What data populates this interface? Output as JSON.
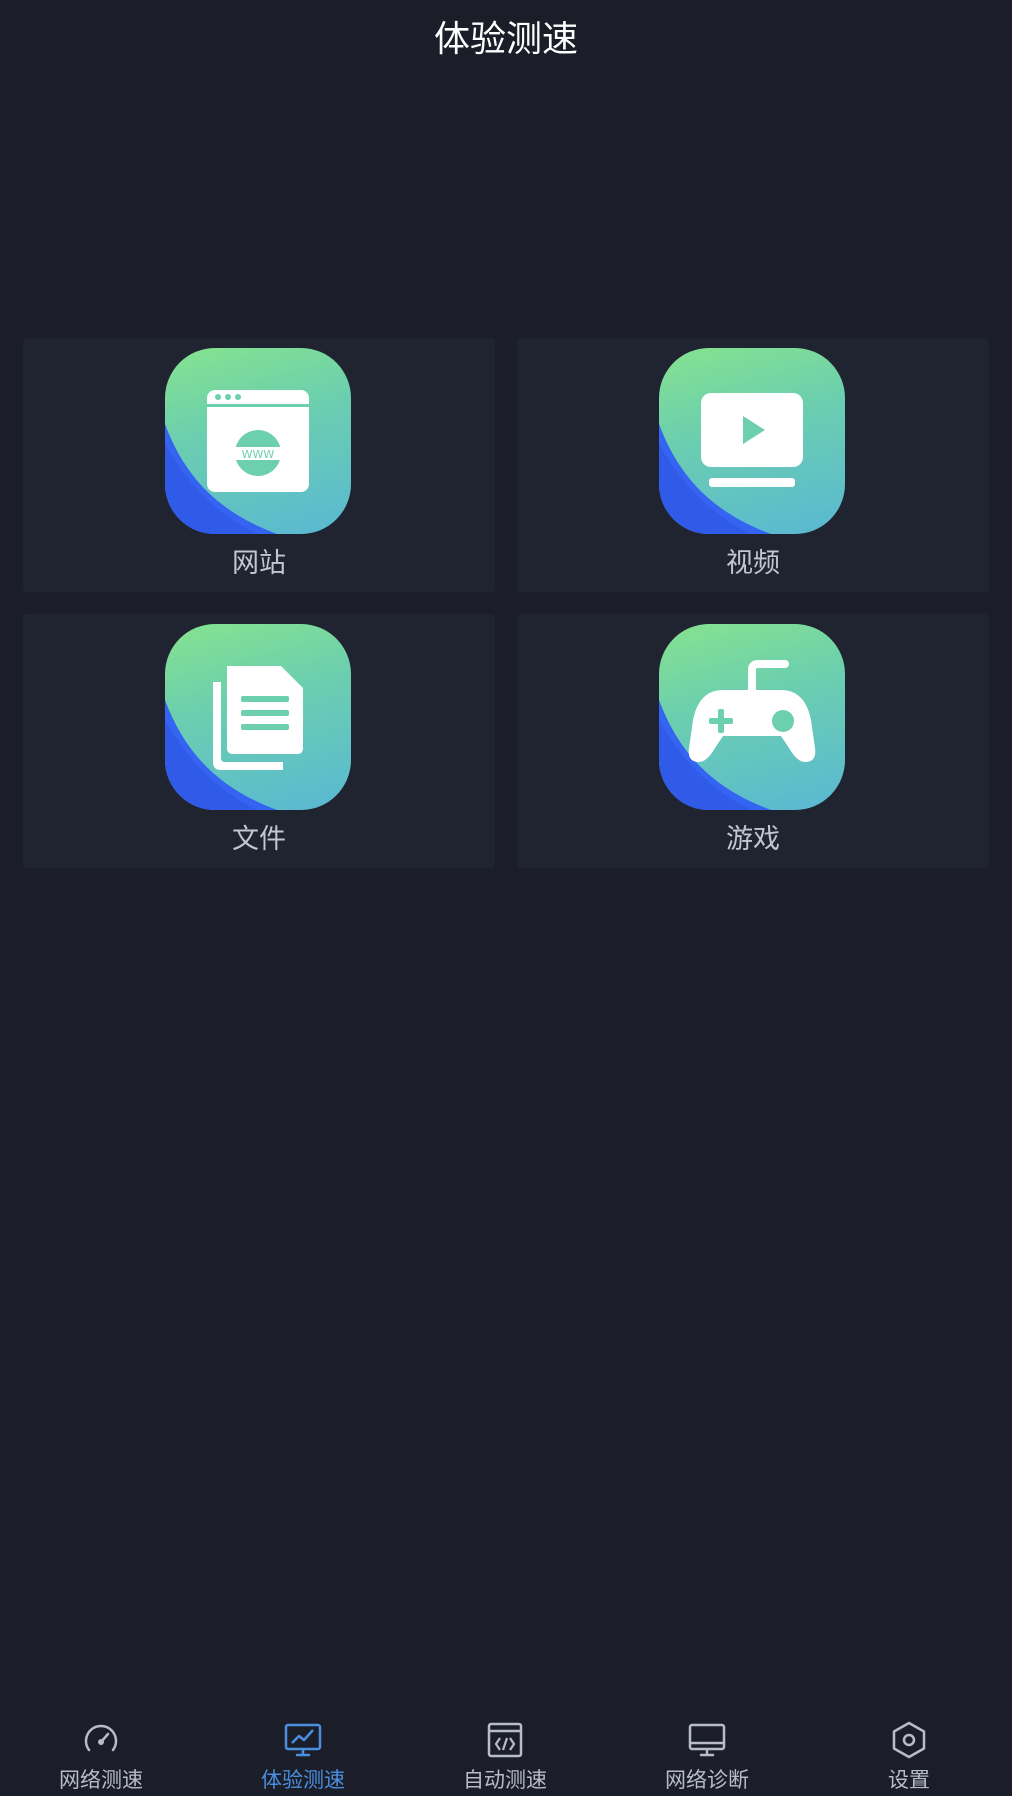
{
  "header": {
    "title": "体验测速"
  },
  "cards": [
    {
      "label": "网站",
      "icon": "website-icon"
    },
    {
      "label": "视频",
      "icon": "video-icon"
    },
    {
      "label": "文件",
      "icon": "file-icon"
    },
    {
      "label": "游戏",
      "icon": "game-controller-icon"
    }
  ],
  "website_icon_text": "WWW",
  "tabbar": {
    "items": [
      {
        "label": "网络测速",
        "icon": "speedometer-icon",
        "active": false
      },
      {
        "label": "体验测速",
        "icon": "monitor-chart-icon",
        "active": true
      },
      {
        "label": "自动测速",
        "icon": "code-window-icon",
        "active": false
      },
      {
        "label": "网络诊断",
        "icon": "desktop-icon",
        "active": false
      },
      {
        "label": "设置",
        "icon": "hexagon-settings-icon",
        "active": false
      }
    ]
  },
  "colors": {
    "background": "#1b1e29",
    "card": "#202431",
    "active_tab": "#4a8fe0",
    "inactive_tab": "#b8bcc6",
    "tile_gradient_top": "#86e38e",
    "tile_gradient_bottom": "#59b8d3",
    "tile_accent": "#3563f2"
  }
}
